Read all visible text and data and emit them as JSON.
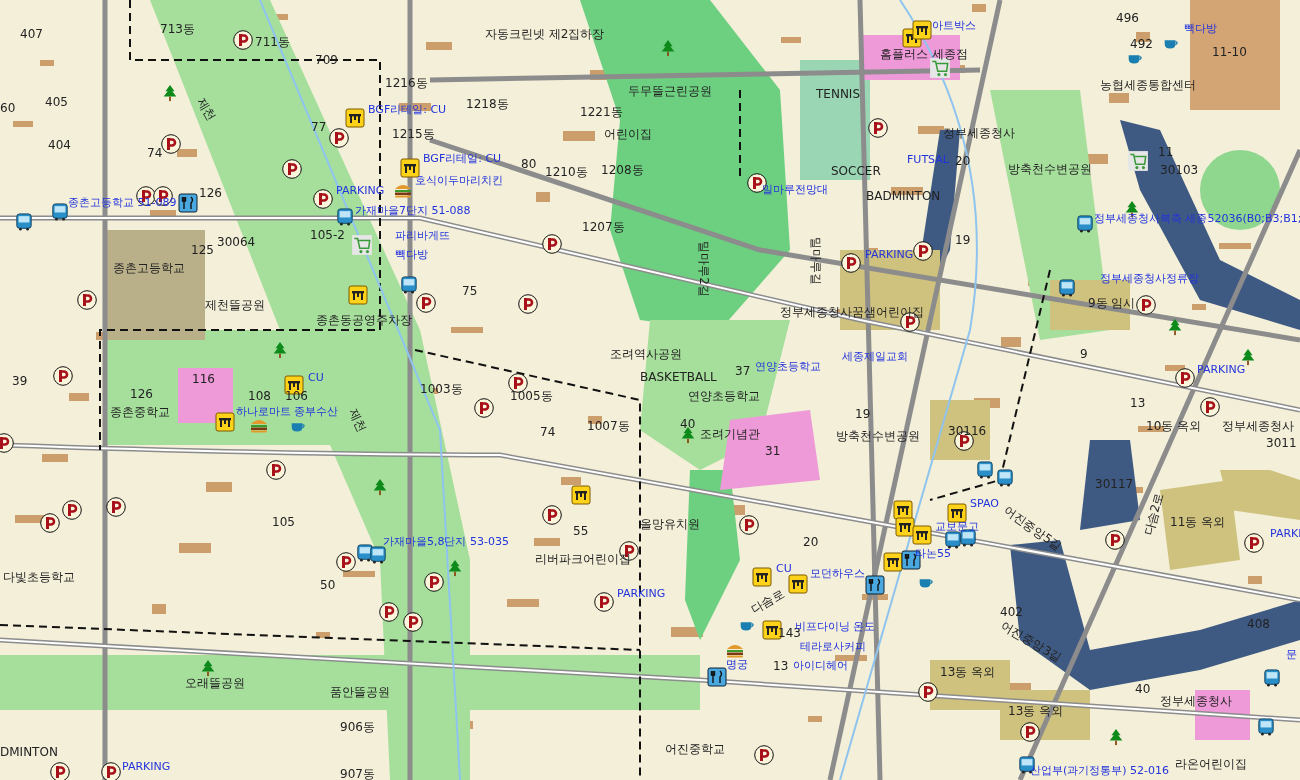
{
  "map": {
    "labels": [
      {
        "text": "407",
        "kind": "number"
      },
      {
        "text": "713동",
        "kind": "number"
      },
      {
        "text": "711동",
        "kind": "number"
      },
      {
        "text": "709",
        "kind": "number"
      },
      {
        "text": "자동크린넷 제2집하장",
        "kind": "place"
      },
      {
        "text": "아트박스",
        "kind": "poi"
      },
      {
        "text": "496",
        "kind": "number"
      },
      {
        "text": "492",
        "kind": "number"
      },
      {
        "text": "빽다방",
        "kind": "poi"
      },
      {
        "text": "홈플러스 세종점",
        "kind": "place"
      },
      {
        "text": "11-10",
        "kind": "number"
      },
      {
        "text": "1216동",
        "kind": "number"
      },
      {
        "text": "두무뜰근린공원",
        "kind": "place"
      },
      {
        "text": "TENNIS",
        "kind": "place"
      },
      {
        "text": "농협세종통합센터",
        "kind": "place"
      },
      {
        "text": "60",
        "kind": "number"
      },
      {
        "text": "405",
        "kind": "number"
      },
      {
        "text": "BGF리테일: CU",
        "kind": "poi"
      },
      {
        "text": "1218동",
        "kind": "number"
      },
      {
        "text": "1221동",
        "kind": "number"
      },
      {
        "text": "404",
        "kind": "number"
      },
      {
        "text": "77",
        "kind": "number"
      },
      {
        "text": "1215동",
        "kind": "number"
      },
      {
        "text": "어린이집",
        "kind": "place"
      },
      {
        "text": "정부세종청사",
        "kind": "place"
      },
      {
        "text": "74",
        "kind": "number"
      },
      {
        "text": "BGF리테일: CU",
        "kind": "poi"
      },
      {
        "text": "호식이두마리치킨",
        "kind": "poi"
      },
      {
        "text": "80",
        "kind": "number"
      },
      {
        "text": "1210동",
        "kind": "number"
      },
      {
        "text": "1208동",
        "kind": "number"
      },
      {
        "text": "SOCCER",
        "kind": "place"
      },
      {
        "text": "FUTSAL",
        "kind": "poi"
      },
      {
        "text": "20",
        "kind": "number"
      },
      {
        "text": "방축천수변공원",
        "kind": "place"
      },
      {
        "text": "11",
        "kind": "number"
      },
      {
        "text": "30103",
        "kind": "number"
      },
      {
        "text": "종촌고등학교 51-089",
        "kind": "poi"
      },
      {
        "text": "126",
        "kind": "number"
      },
      {
        "text": "PARKING",
        "kind": "poi"
      },
      {
        "text": "밀마루전망대",
        "kind": "poi"
      },
      {
        "text": "BADMINTON",
        "kind": "place"
      },
      {
        "text": "가재마을7단지 51-088",
        "kind": "poi"
      },
      {
        "text": "1207동",
        "kind": "number"
      },
      {
        "text": "정부세종청사북측 세종52036(B0;B3;B1;",
        "kind": "poi"
      },
      {
        "text": "125",
        "kind": "number"
      },
      {
        "text": "30064",
        "kind": "number"
      },
      {
        "text": "105-2",
        "kind": "number"
      },
      {
        "text": "파리바게뜨",
        "kind": "poi"
      },
      {
        "text": "19",
        "kind": "number"
      },
      {
        "text": "종촌고등학교",
        "kind": "place"
      },
      {
        "text": "빽다방",
        "kind": "poi"
      },
      {
        "text": "밀마루2길",
        "kind": "road"
      },
      {
        "text": "밀마루길",
        "kind": "road"
      },
      {
        "text": "PARKING",
        "kind": "poi"
      },
      {
        "text": "75",
        "kind": "number"
      },
      {
        "text": "정부세종청사정류장",
        "kind": "poi"
      },
      {
        "text": "제천뜰공원",
        "kind": "place"
      },
      {
        "text": "정부세종청사꿈샘어린이집",
        "kind": "place"
      },
      {
        "text": "9동 임시",
        "kind": "number"
      },
      {
        "text": "종촌동공영주차장",
        "kind": "place"
      },
      {
        "text": "39",
        "kind": "number"
      },
      {
        "text": "116",
        "kind": "number"
      },
      {
        "text": "CU",
        "kind": "poi"
      },
      {
        "text": "조려역사공원",
        "kind": "place"
      },
      {
        "text": "BASKETBALL",
        "kind": "place"
      },
      {
        "text": "37",
        "kind": "number"
      },
      {
        "text": "연양초등학교",
        "kind": "poi"
      },
      {
        "text": "세종제일교회",
        "kind": "poi"
      },
      {
        "text": "9",
        "kind": "number"
      },
      {
        "text": "PARKING",
        "kind": "poi"
      },
      {
        "text": "126",
        "kind": "number"
      },
      {
        "text": "종촌중학교",
        "kind": "place"
      },
      {
        "text": "108",
        "kind": "number"
      },
      {
        "text": "106",
        "kind": "number"
      },
      {
        "text": "하나로마트 종부수산",
        "kind": "poi"
      },
      {
        "text": "1003동",
        "kind": "number"
      },
      {
        "text": "1005동",
        "kind": "number"
      },
      {
        "text": "연양초등학교",
        "kind": "place"
      },
      {
        "text": "19",
        "kind": "number"
      },
      {
        "text": "13",
        "kind": "number"
      },
      {
        "text": "74",
        "kind": "number"
      },
      {
        "text": "1007동",
        "kind": "number"
      },
      {
        "text": "40",
        "kind": "number"
      },
      {
        "text": "조려기념관",
        "kind": "place"
      },
      {
        "text": "31",
        "kind": "number"
      },
      {
        "text": "방축천수변공원",
        "kind": "place"
      },
      {
        "text": "30116",
        "kind": "number"
      },
      {
        "text": "10동 옥외",
        "kind": "number"
      },
      {
        "text": "정부세종청사",
        "kind": "place"
      },
      {
        "text": "3011",
        "kind": "number"
      },
      {
        "text": "30117",
        "kind": "number"
      },
      {
        "text": "SPAO",
        "kind": "poi"
      },
      {
        "text": "105",
        "kind": "number"
      },
      {
        "text": "가재마을5,8단지 53-035",
        "kind": "poi"
      },
      {
        "text": "55",
        "kind": "number"
      },
      {
        "text": "올망유치원",
        "kind": "place"
      },
      {
        "text": "20",
        "kind": "number"
      },
      {
        "text": "교보문고",
        "kind": "poi"
      },
      {
        "text": "어진중앙5길",
        "kind": "road"
      },
      {
        "text": "다솜2로",
        "kind": "road"
      },
      {
        "text": "11동 옥외",
        "kind": "number"
      },
      {
        "text": "PARKI",
        "kind": "poi"
      },
      {
        "text": "다빛초등학교",
        "kind": "place"
      },
      {
        "text": "50",
        "kind": "number"
      },
      {
        "text": "리버파크어린이집",
        "kind": "place"
      },
      {
        "text": "PARKING",
        "kind": "poi"
      },
      {
        "text": "CU",
        "kind": "poi"
      },
      {
        "text": "모던하우스",
        "kind": "poi"
      },
      {
        "text": "타논55",
        "kind": "poi"
      },
      {
        "text": "다솜로",
        "kind": "road"
      },
      {
        "text": "143",
        "kind": "number"
      },
      {
        "text": "비프다이닝 온도",
        "kind": "poi"
      },
      {
        "text": "테라로사커피",
        "kind": "poi"
      },
      {
        "text": "402",
        "kind": "number"
      },
      {
        "text": "어진중앙3길",
        "kind": "road"
      },
      {
        "text": "408",
        "kind": "number"
      },
      {
        "text": "문",
        "kind": "poi"
      },
      {
        "text": "오래뜰공원",
        "kind": "place"
      },
      {
        "text": "품안뜰공원",
        "kind": "place"
      },
      {
        "text": "명궁",
        "kind": "poi"
      },
      {
        "text": "13",
        "kind": "number"
      },
      {
        "text": "아이디헤어",
        "kind": "poi"
      },
      {
        "text": "13동 옥외",
        "kind": "number"
      },
      {
        "text": "13동 옥외",
        "kind": "number"
      },
      {
        "text": "40",
        "kind": "number"
      },
      {
        "text": "정부세종청사",
        "kind": "place"
      },
      {
        "text": "906동",
        "kind": "number"
      },
      {
        "text": "DMINTON",
        "kind": "place"
      },
      {
        "text": "PARKING",
        "kind": "poi"
      },
      {
        "text": "907동",
        "kind": "number"
      },
      {
        "text": "어진중학교",
        "kind": "place"
      },
      {
        "text": "산업부(과기정통부) 52-016",
        "kind": "poi"
      },
      {
        "text": "라온어린이집",
        "kind": "place"
      },
      {
        "text": "제천",
        "kind": "road"
      },
      {
        "text": "제천",
        "kind": "road"
      }
    ]
  }
}
